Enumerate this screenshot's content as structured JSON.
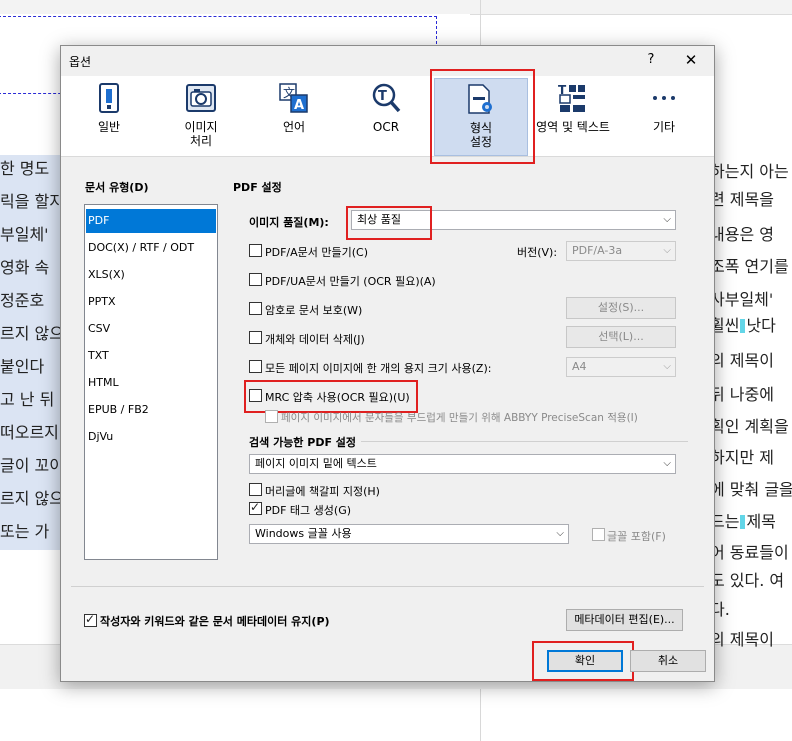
{
  "background": {
    "left_lines": [
      "한 명도",
      "릭을 할지",
      "부일체'",
      " 영화 속",
      "정준호",
      "르지 않으",
      "붙인다",
      "고 난 뒤",
      "떠오르지",
      "글이 꼬이",
      "르지 않으",
      "또는 가"
    ],
    "right_lines_a": [
      "하는지 아는",
      "련 제목을 ",
      "내용은 영",
      "조폭 연기를",
      "사부일체' ",
      "휠씬",
      "낫다",
      "의 제목이 ",
      "뒤 나중에",
      "획인 계획을",
      "하지만 제",
      "에 맞춰 글을",
      "드는",
      "제목",
      "어 동료들이",
      "도 있다. 여",
      "다.",
      "의 제목이"
    ]
  },
  "dialog": {
    "title": "옵션",
    "help_label": "?",
    "close_label": "✕",
    "toolbar": [
      {
        "label": "일반",
        "icon": "general-settings-icon"
      },
      {
        "label": "이미지\n처리",
        "icon": "camera-icon"
      },
      {
        "label": "언어",
        "icon": "language-icon"
      },
      {
        "label": "OCR",
        "icon": "ocr-magnifier-icon"
      },
      {
        "label": "형식\n설정",
        "icon": "format-settings-icon"
      },
      {
        "label": "영역 및 텍스트",
        "icon": "areas-text-icon"
      },
      {
        "label": "기타",
        "icon": "more-icon"
      }
    ],
    "doc_type_label": "문서 유형(D)",
    "doc_types": [
      "PDF",
      "DOC(X) / RTF / ODT",
      "XLS(X)",
      "PPTX",
      "CSV",
      "TXT",
      "HTML",
      "EPUB / FB2",
      "DjVu"
    ],
    "selected_doc_type": "PDF",
    "pdf_settings_title": "PDF 설정",
    "image_quality_label": "이미지 품질(M):",
    "image_quality_value": "최상 품질",
    "pdfa_label": "PDF/A문서 만들기(C)",
    "version_label": "버전(V):",
    "version_value": "PDF/A-3a",
    "pdfua_label": "PDF/UA문서 만들기 (OCR 필요)(A)",
    "password_label": "암호로 문서 보호(W)",
    "password_button": "설정(S)...",
    "delete_objects_label": "개체와 데이터 삭제(J)",
    "delete_objects_button": "선택(L)...",
    "one_paper_size_label": "모든 페이지 이미지에 한 개의 용지 크기 사용(Z):",
    "paper_size_value": "A4",
    "mrc_label": "MRC 압축 사용(OCR 필요)(U)",
    "precisescan_label": "페이지 이미지에서 문자들을 부드럽게 만들기 위해 ABBYY PreciseScan 적용(I)",
    "searchable_title": "검색 가능한 PDF 설정",
    "searchable_value": "페이지 이미지 밑에 텍스트",
    "bookmarks_label": "머리글에 책갈피 지정(H)",
    "pdf_tags_label": "PDF 태그 생성(G)",
    "font_value": "Windows 글꼴 사용",
    "embed_fonts_label": "글꼴 포함(F)",
    "keep_metadata_label": "작성자와 키워드와 같은 문서 메타데이터 유지(P)",
    "edit_metadata_button": "메타데이터 편집(E)...",
    "ok_button": "확인",
    "cancel_button": "취소",
    "checks": {
      "pdfa": false,
      "pdfua": false,
      "password": false,
      "delete_objects": false,
      "one_paper_size": false,
      "mrc": false,
      "precisescan": false,
      "bookmarks": false,
      "pdf_tags": true,
      "embed_fonts": false,
      "keep_metadata": true
    },
    "colors": {
      "highlight_red": "#e02020",
      "selection_blue": "#0078d7",
      "toolbar_selected": "#cfdcf0"
    }
  }
}
